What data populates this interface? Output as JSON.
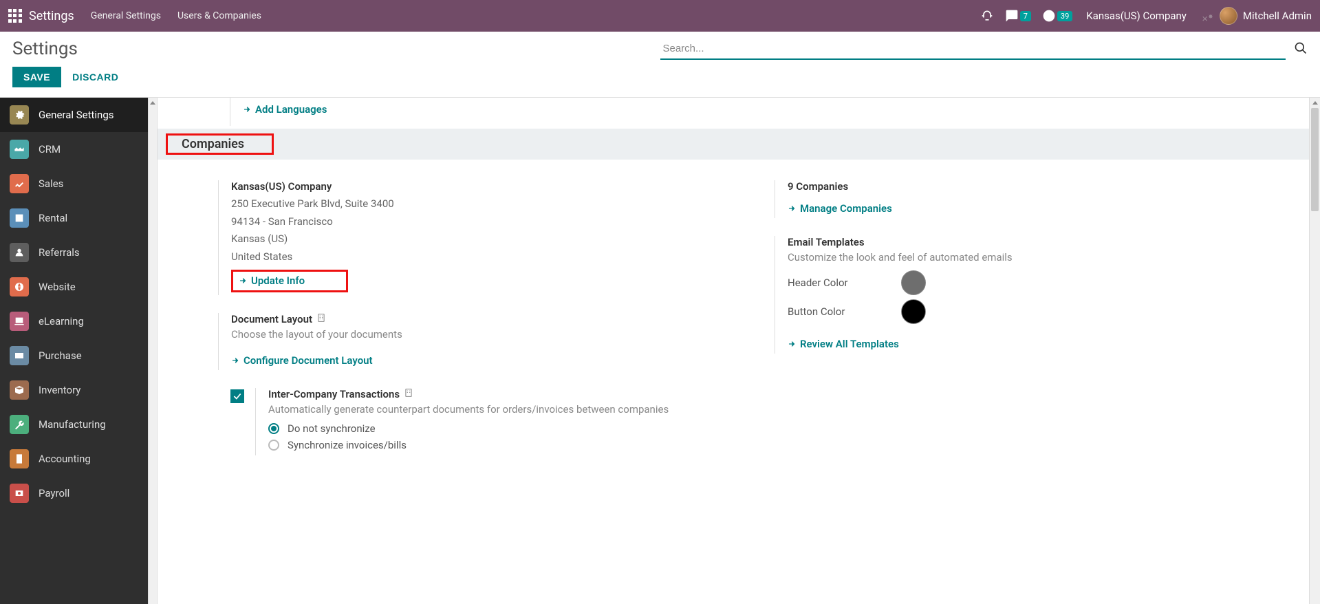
{
  "menubar": {
    "brand": "Settings",
    "items": [
      "General Settings",
      "Users & Companies"
    ],
    "messages_badge": "7",
    "activities_badge": "39",
    "company": "Kansas(US) Company",
    "user": "Mitchell Admin"
  },
  "controlbar": {
    "title": "Settings",
    "search_placeholder": "Search...",
    "save": "SAVE",
    "discard": "DISCARD"
  },
  "sidebar": {
    "items": [
      {
        "label": "General Settings"
      },
      {
        "label": "CRM"
      },
      {
        "label": "Sales"
      },
      {
        "label": "Rental"
      },
      {
        "label": "Referrals"
      },
      {
        "label": "Website"
      },
      {
        "label": "eLearning"
      },
      {
        "label": "Purchase"
      },
      {
        "label": "Inventory"
      },
      {
        "label": "Manufacturing"
      },
      {
        "label": "Accounting"
      },
      {
        "label": "Payroll"
      }
    ]
  },
  "content": {
    "add_languages": "Add Languages",
    "section_title": "Companies",
    "company": {
      "name": "Kansas(US) Company",
      "street": "250 Executive Park Blvd, Suite 3400",
      "zip_city": "94134 - San Francisco",
      "state": "Kansas (US)",
      "country": "United States",
      "update_info": "Update Info"
    },
    "doc_layout": {
      "title": "Document Layout",
      "desc": "Choose the layout of your documents",
      "link": "Configure Document Layout"
    },
    "intercompany": {
      "title": "Inter-Company Transactions",
      "desc": "Automatically generate counterpart documents for orders/invoices between companies",
      "opt1": "Do not synchronize",
      "opt2": "Synchronize invoices/bills"
    },
    "right": {
      "companies_count": "9 Companies",
      "manage": "Manage Companies",
      "email_title": "Email Templates",
      "email_desc": "Customize the look and feel of automated emails",
      "header_color_label": "Header Color",
      "header_color": "#6e6e6e",
      "button_color_label": "Button Color",
      "button_color": "#000000",
      "review": "Review All Templates"
    }
  }
}
